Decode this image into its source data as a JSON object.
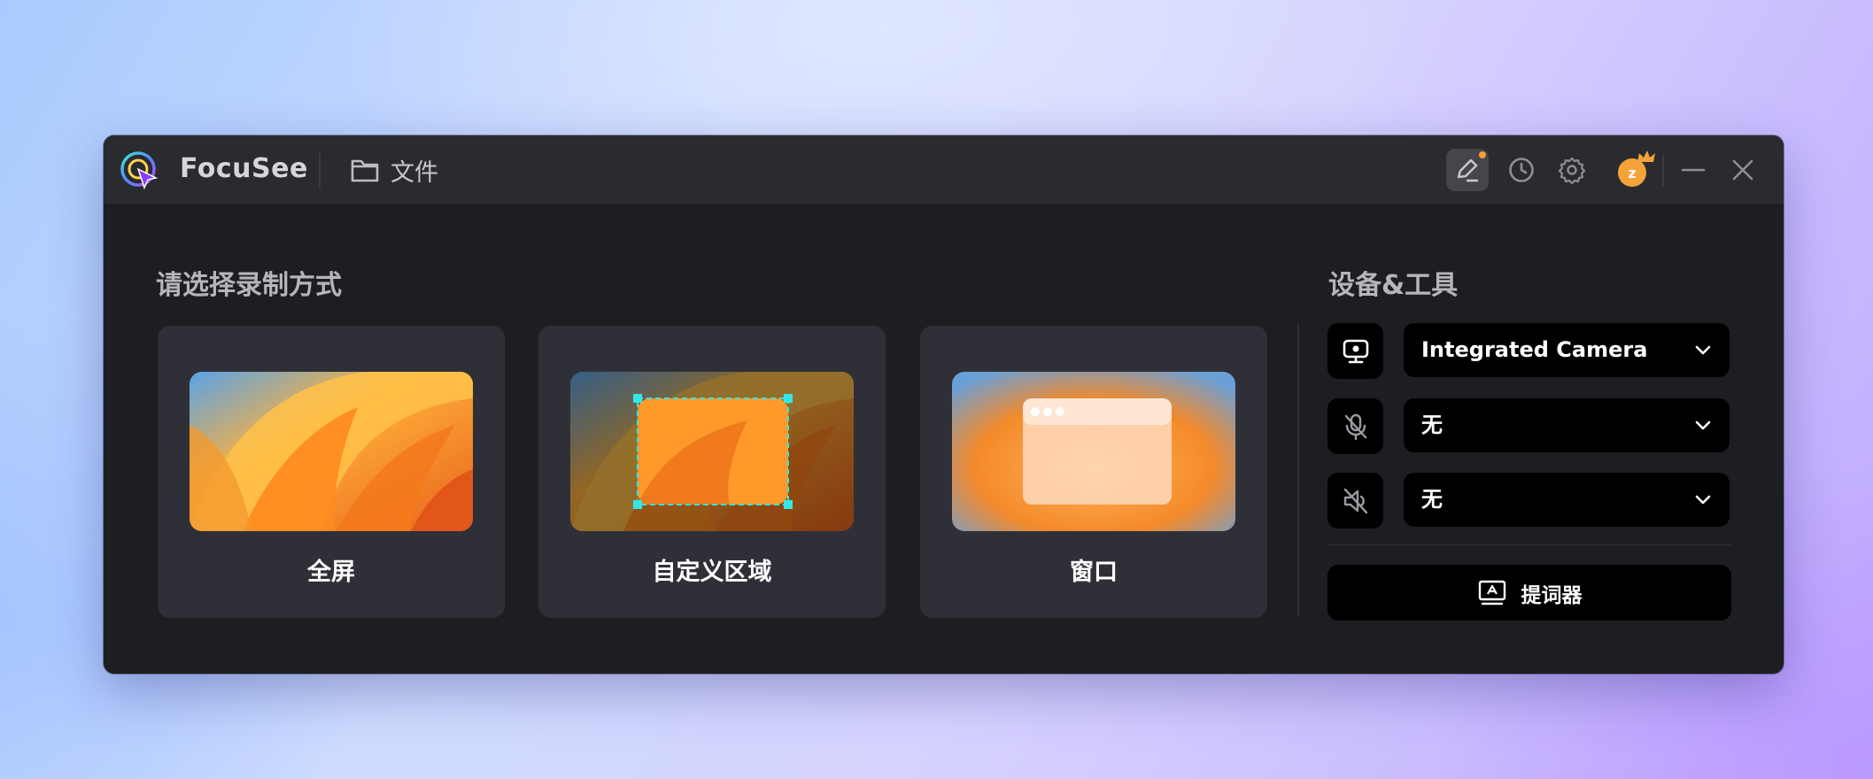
{
  "app": {
    "name": "FocuSee"
  },
  "header": {
    "files_label": "文件",
    "avatar_letter": "z"
  },
  "record": {
    "title": "请选择录制方式",
    "modes": [
      {
        "label": "全屏"
      },
      {
        "label": "自定义区域"
      },
      {
        "label": "窗口"
      }
    ]
  },
  "devices": {
    "title": "设备&工具",
    "camera": {
      "value": "Integrated Camera"
    },
    "microphone": {
      "value": "无"
    },
    "speaker": {
      "value": "无"
    },
    "prompter_label": "提词器"
  },
  "colors": {
    "accent_orange": "#ff9a2e",
    "selection_cyan": "#35e6e6"
  }
}
